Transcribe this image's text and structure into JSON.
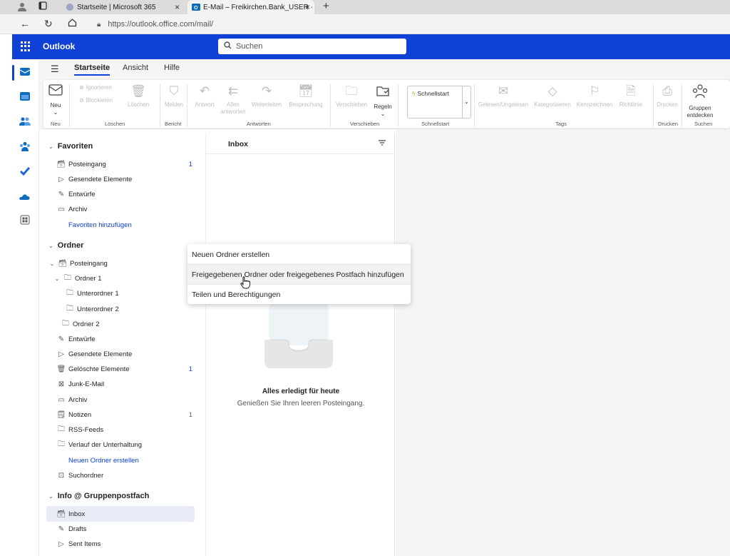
{
  "browser": {
    "tabs": [
      {
        "title": "Startseite | Microsoft 365"
      },
      {
        "title": "E-Mail – Freikirchen.Bank_USER ·"
      }
    ],
    "url": "https://outlook.office.com/mail/"
  },
  "header": {
    "app_name": "Outlook",
    "search_placeholder": "Suchen",
    "accent": "#0f41d6"
  },
  "ribbon": {
    "tabs": [
      "Startseite",
      "Ansicht",
      "Hilfe"
    ],
    "active_tab": "Startseite",
    "new": {
      "label": "Neu",
      "group": "Neu"
    },
    "ignore": "Ignorieren",
    "block": "Blockieren",
    "delete": "Löschen",
    "delete_group": "Löschen",
    "report": "Melden",
    "report_group": "Bericht",
    "reply": "Antwort",
    "reply_all_1": "Allen",
    "reply_all_2": "antworten",
    "forward": "Weiterleiten",
    "meeting": "Besprechung",
    "respond_group": "Antworten",
    "move": "Verschieben",
    "rules": "Regeln",
    "move_group": "Verschieben",
    "quickstep": "Schnellstart",
    "quickstep_group": "Schnellstart",
    "read_unread": "Gelesen/Ungelesen",
    "categorize": "Kategorisieren",
    "flag": "Kennzeichnen",
    "policy": "Richtlinie",
    "tags_group": "Tags",
    "print": "Drucken",
    "print_group": "Drucken",
    "groups_1": "Gruppen",
    "groups_2": "entdecken",
    "search_group": "Suchen"
  },
  "folders": {
    "favorites_title": "Favoriten",
    "favorites": [
      {
        "label": "Posteingang",
        "count": "1"
      },
      {
        "label": "Gesendete Elemente",
        "count": ""
      },
      {
        "label": "Entwürfe",
        "count": ""
      },
      {
        "label": "Archiv",
        "count": ""
      }
    ],
    "add_favorites": "Favoriten hinzufügen",
    "folders_title": "Ordner",
    "inbox": "Posteingang",
    "folder1": "Ordner 1",
    "sub1": "Unterordner 1",
    "sub2": "Unterordner 2",
    "folder2": "Ordner 2",
    "others": [
      {
        "label": "Entwürfe",
        "count": ""
      },
      {
        "label": "Gesendete Elemente",
        "count": ""
      },
      {
        "label": "Gelöschte Elemente",
        "count": "1"
      },
      {
        "label": "Junk-E-Mail",
        "count": ""
      },
      {
        "label": "Archiv",
        "count": ""
      },
      {
        "label": "Notizen",
        "count": "1"
      },
      {
        "label": "RSS-Feeds",
        "count": ""
      },
      {
        "label": "Verlauf der Unterhaltung",
        "count": ""
      }
    ],
    "new_folder": "Neuen Ordner erstellen",
    "search_folders": "Suchordner",
    "group_mailbox_title": "Info @ Gruppenpostfach",
    "group_items": [
      "Inbox",
      "Drafts",
      "Sent Items"
    ]
  },
  "mail_list": {
    "title": "Inbox",
    "empty_title": "Alles erledigt für heute",
    "empty_sub": "Genießen Sie Ihren leeren Posteingang."
  },
  "context_menu": {
    "items": [
      "Neuen Ordner erstellen",
      "Freigegebenen Ordner oder freigegebenes Postfach hinzufügen",
      "Teilen und Berechtigungen"
    ]
  }
}
